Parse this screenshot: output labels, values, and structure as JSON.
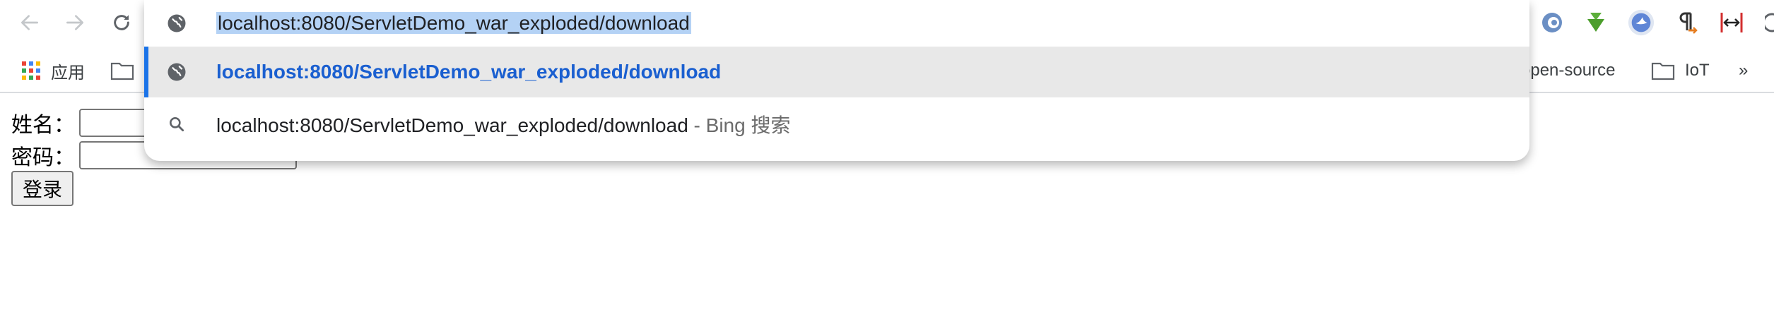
{
  "browser": {
    "address_bar": {
      "url": "localhost:8080/ServletDemo_war_exploded/download"
    },
    "bookmarks": {
      "apps_label": "应用",
      "opensource_label": "open-source",
      "iot_label": "IoT",
      "overflow_label": "»"
    },
    "suggestions": {
      "selected_text": "localhost:8080/ServletDemo_war_exploded/download",
      "bing_query": "localhost:8080/ServletDemo_war_exploded/download",
      "bing_suffix": " - Bing 搜索"
    }
  },
  "page": {
    "form": {
      "name_label": "姓名：",
      "password_label": "密码：",
      "login_label": "登录"
    }
  },
  "colors": {
    "accent": "#1a73e8",
    "selected_text": "#1a5fd0",
    "highlight": "#b4d2f5"
  }
}
